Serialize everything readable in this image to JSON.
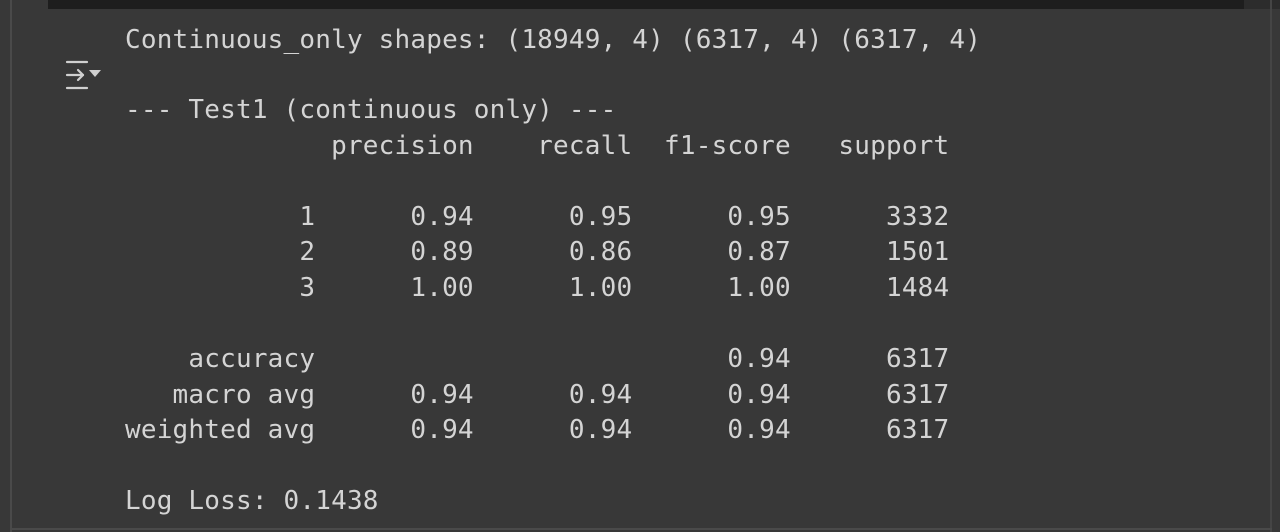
{
  "toolbar": {
    "output_toggle_icon": "output-collapse-icon"
  },
  "output": {
    "shapes_line": "Continuous_only shapes: (18949, 4) (6317, 4) (6317, 4)",
    "test_header": "--- Test1 (continuous only) ---",
    "report": {
      "columns": [
        "precision",
        "recall",
        "f1-score",
        "support"
      ],
      "rows": [
        {
          "label": "1",
          "precision": "0.94",
          "recall": "0.95",
          "f1": "0.95",
          "support": "3332"
        },
        {
          "label": "2",
          "precision": "0.89",
          "recall": "0.86",
          "f1": "0.87",
          "support": "1501"
        },
        {
          "label": "3",
          "precision": "1.00",
          "recall": "1.00",
          "f1": "1.00",
          "support": "1484"
        }
      ],
      "summary": [
        {
          "label": "accuracy",
          "precision": "",
          "recall": "",
          "f1": "0.94",
          "support": "6317"
        },
        {
          "label": "macro avg",
          "precision": "0.94",
          "recall": "0.94",
          "f1": "0.94",
          "support": "6317"
        },
        {
          "label": "weighted avg",
          "precision": "0.94",
          "recall": "0.94",
          "f1": "0.94",
          "support": "6317"
        }
      ]
    },
    "log_loss_line": "Log Loss: 0.1438"
  },
  "colors": {
    "background": "#383838",
    "text": "#d4d4d4",
    "top_bar": "#1e1e1e"
  }
}
